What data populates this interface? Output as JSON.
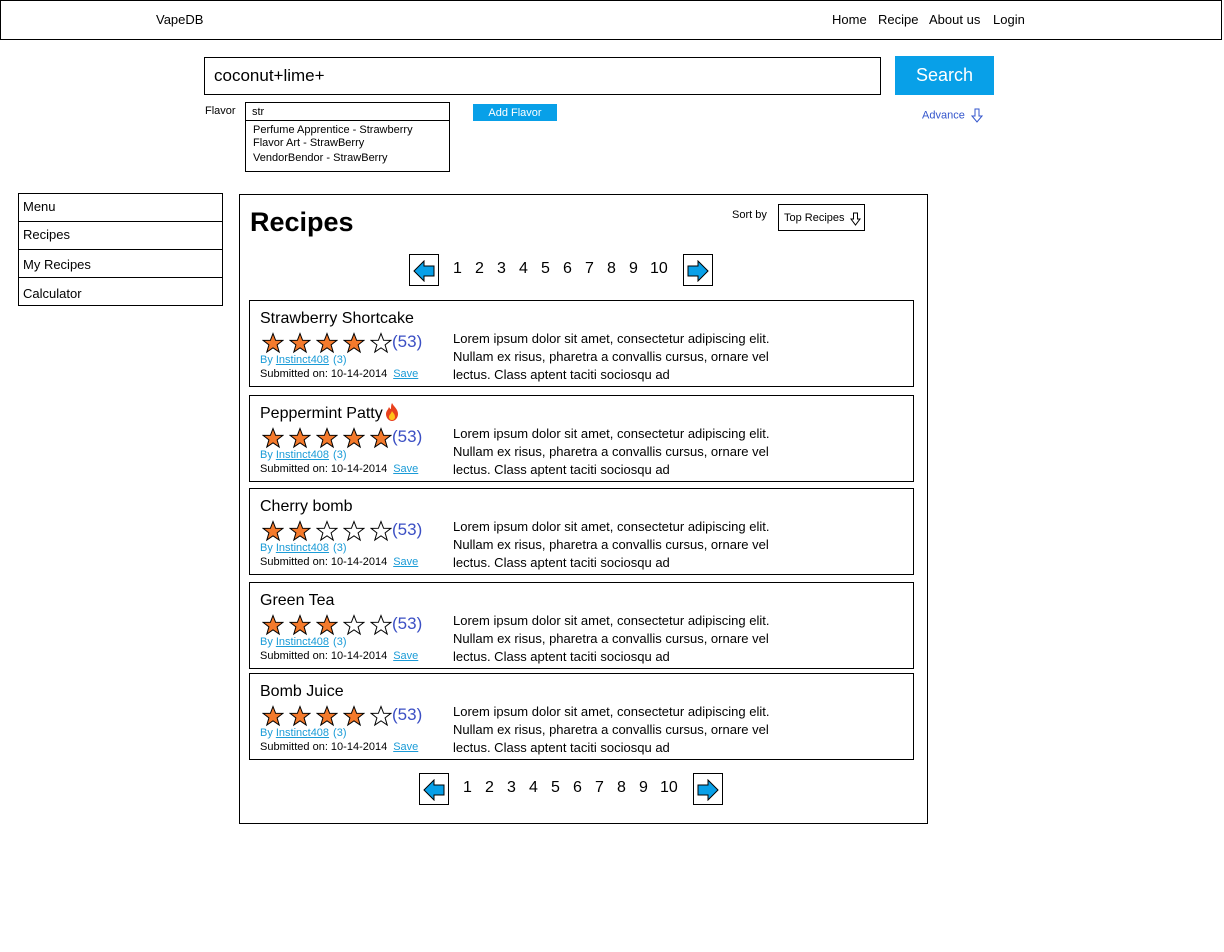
{
  "nav": {
    "brand": "VapeDB",
    "links": [
      "Home",
      "Recipe",
      "About us",
      "Login"
    ]
  },
  "search": {
    "query": "coconut+lime+",
    "button_label": "Search",
    "flavor_label": "Flavor",
    "flavor_query": "str",
    "suggestions": [
      "Perfume Apprentice - Strawberry",
      "Flavor Art - StrawBerry",
      "VendorBendor - StrawBerry"
    ],
    "add_flavor_label": "Add Flavor",
    "advance_label": "Advance"
  },
  "sidebar": {
    "items": [
      "Menu",
      "Recipes",
      "My Recipes",
      "Calculator"
    ]
  },
  "main": {
    "title": "Recipes",
    "sort_label": "Sort by",
    "sort_value": "Top Recipes",
    "pages": [
      "1",
      "2",
      "3",
      "4",
      "5",
      "6",
      "7",
      "8",
      "9",
      "10"
    ],
    "recipes": [
      {
        "name": "Strawberry Shortcake",
        "rating": 4,
        "rating_count": "(53)",
        "by": "By",
        "author": "Instinct408",
        "author_count": "(3)",
        "submitted": "Submitted on: 10-14-2014",
        "save": "Save",
        "desc": "Lorem ipsum dolor sit amet, consectetur adipiscing elit. Nullam ex risus, pharetra a convallis cursus, ornare vel lectus. Class aptent taciti sociosqu ad",
        "hot": false
      },
      {
        "name": "Peppermint Patty",
        "rating": 5,
        "rating_count": "(53)",
        "by": "By",
        "author": "Instinct408",
        "author_count": "(3)",
        "submitted": "Submitted on: 10-14-2014",
        "save": "Save",
        "desc": "Lorem ipsum dolor sit amet, consectetur adipiscing elit. Nullam ex risus, pharetra a convallis cursus, ornare vel lectus. Class aptent taciti sociosqu ad",
        "hot": true
      },
      {
        "name": "Cherry bomb",
        "rating": 2,
        "rating_count": "(53)",
        "by": "By",
        "author": "Instinct408",
        "author_count": "(3)",
        "submitted": "Submitted on: 10-14-2014",
        "save": "Save",
        "desc": "Lorem ipsum dolor sit amet, consectetur adipiscing elit. Nullam ex risus, pharetra a convallis cursus, ornare vel lectus. Class aptent taciti sociosqu ad",
        "hot": false
      },
      {
        "name": "Green Tea",
        "rating": 3,
        "rating_count": "(53)",
        "by": "By",
        "author": "Instinct408",
        "author_count": "(3)",
        "submitted": "Submitted on: 10-14-2014",
        "save": "Save",
        "desc": "Lorem ipsum dolor sit amet, consectetur adipiscing elit. Nullam ex risus, pharetra a convallis cursus, ornare vel lectus. Class aptent taciti sociosqu ad",
        "hot": false
      },
      {
        "name": "Bomb Juice",
        "rating": 4,
        "rating_count": "(53)",
        "by": "By",
        "author": "Instinct408",
        "author_count": "(3)",
        "submitted": "Submitted on: 10-14-2014",
        "save": "Save",
        "desc": "Lorem ipsum dolor sit amet, consectetur adipiscing elit. Nullam ex risus, pharetra a convallis cursus, ornare vel lectus. Class aptent taciti sociosqu ad",
        "hot": false
      }
    ]
  },
  "colors": {
    "accent": "#08a0e8",
    "star_fill": "#f47a2c",
    "rating_count": "#3b4fc4",
    "link": "#1a9bd7"
  },
  "icons": {
    "prev": "arrow-left-icon",
    "next": "arrow-right-icon",
    "star": "star-icon",
    "hot": "fire-icon",
    "dropdown": "down-arrow-icon"
  }
}
